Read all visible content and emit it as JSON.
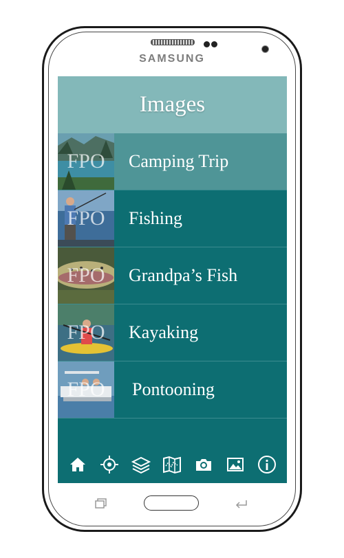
{
  "device": {
    "brand": "SAMSUNG"
  },
  "header": {
    "title": "Images"
  },
  "list": [
    {
      "label": "Camping Trip",
      "thumb_text": "FPO",
      "selected": true
    },
    {
      "label": "Fishing",
      "thumb_text": "FPO",
      "selected": false
    },
    {
      "label": "Grandpa’s Fish",
      "thumb_text": "FPO",
      "selected": false
    },
    {
      "label": "Kayaking",
      "thumb_text": "FPO",
      "selected": false
    },
    {
      "label": "Pontooning",
      "thumb_text": "FPO",
      "selected": false
    }
  ],
  "toolbar": {
    "icons": [
      "home-icon",
      "locate-icon",
      "layers-icon",
      "map-icon",
      "camera-icon",
      "image-icon",
      "info-icon"
    ]
  },
  "colors": {
    "screen_bg": "#0d6e72",
    "header_bg": "#83b8b9",
    "selected_row": "#4f9597",
    "text": "#ffffff"
  }
}
